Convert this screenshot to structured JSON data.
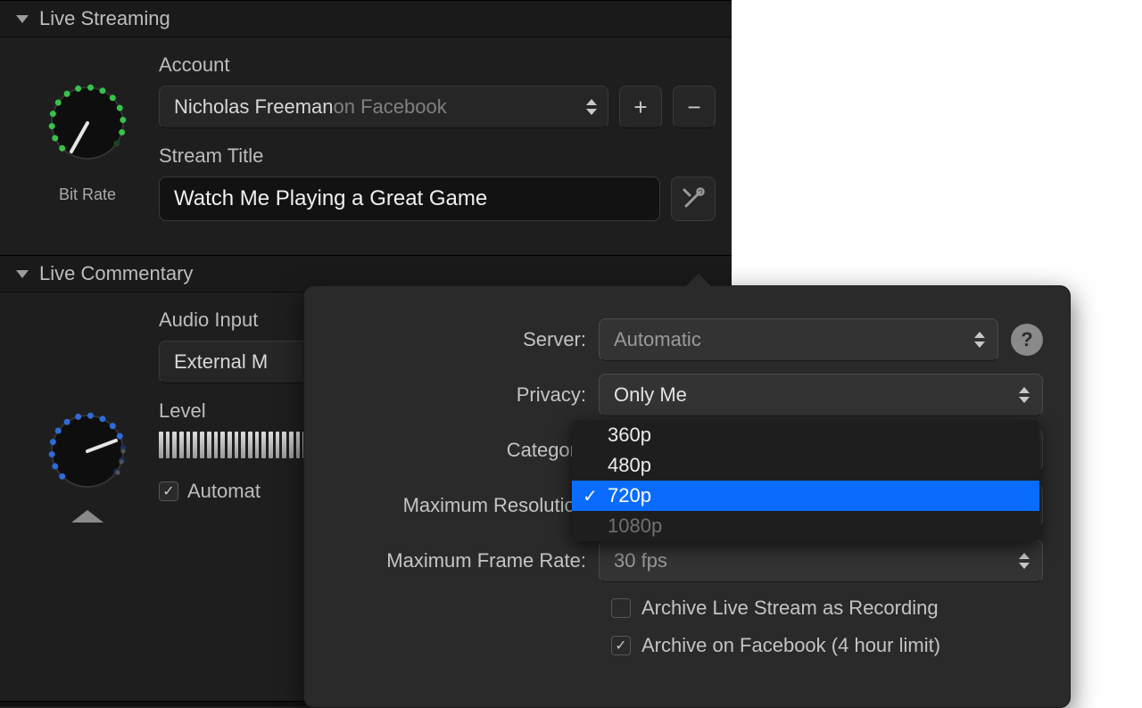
{
  "sections": {
    "streaming": {
      "title": "Live Streaming",
      "bitrate_caption": "Bit Rate",
      "account_label": "Account",
      "account_name": "Nicholas Freeman",
      "account_platform": " on Facebook",
      "stream_title_label": "Stream Title",
      "stream_title_value": "Watch Me Playing a Great Game"
    },
    "commentary": {
      "title": "Live Commentary",
      "audio_input_label": "Audio Input",
      "audio_input_value": "External M",
      "level_label": "Level",
      "auto_label": "Automat"
    }
  },
  "popover": {
    "server_label": "Server:",
    "server_value": "Automatic",
    "privacy_label": "Privacy:",
    "privacy_value": "Only Me",
    "category_label": "Category",
    "max_res_label": "Maximum Resolution",
    "max_fps_label": "Maximum Frame Rate:",
    "max_fps_value": "30 fps",
    "archive1": "Archive Live Stream as Recording",
    "archive2": "Archive on Facebook (4 hour limit)",
    "resolution_options": {
      "o0": "360p",
      "o1": "480p",
      "o2": "720p",
      "o3": "1080p"
    }
  }
}
